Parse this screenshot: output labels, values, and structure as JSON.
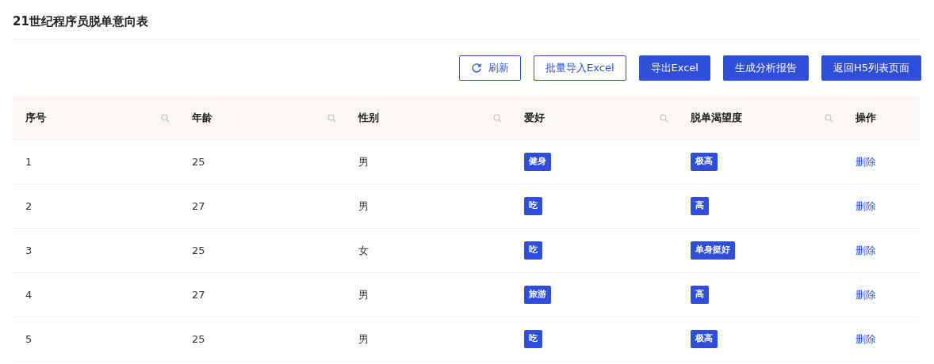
{
  "title": "21世纪程序员脱单意向表",
  "toolbar": [
    {
      "label": "刷新",
      "kind": "refresh"
    },
    {
      "label": "批量导入Excel",
      "kind": "outline"
    },
    {
      "label": "导出Excel",
      "kind": "primary"
    },
    {
      "label": "生成分析报告",
      "kind": "primary"
    },
    {
      "label": "返回H5列表页面",
      "kind": "primary"
    }
  ],
  "table": {
    "columns": [
      {
        "label": "序号",
        "searchable": true
      },
      {
        "label": "年龄",
        "searchable": true
      },
      {
        "label": "性别",
        "searchable": true
      },
      {
        "label": "爱好",
        "searchable": true
      },
      {
        "label": "脱单渴望度",
        "searchable": true
      },
      {
        "label": "操作",
        "searchable": false
      }
    ],
    "rows": [
      {
        "index": "1",
        "age": "25",
        "gender": "男",
        "hobby": "健身",
        "desire": "极高",
        "action": "删除"
      },
      {
        "index": "2",
        "age": "27",
        "gender": "男",
        "hobby": "吃",
        "desire": "高",
        "action": "删除"
      },
      {
        "index": "3",
        "age": "25",
        "gender": "女",
        "hobby": "吃",
        "desire": "单身挺好",
        "action": "删除"
      },
      {
        "index": "4",
        "age": "27",
        "gender": "男",
        "hobby": "旅游",
        "desire": "高",
        "action": "删除"
      },
      {
        "index": "5",
        "age": "25",
        "gender": "男",
        "hobby": "吃",
        "desire": "极高",
        "action": "删除"
      }
    ]
  }
}
